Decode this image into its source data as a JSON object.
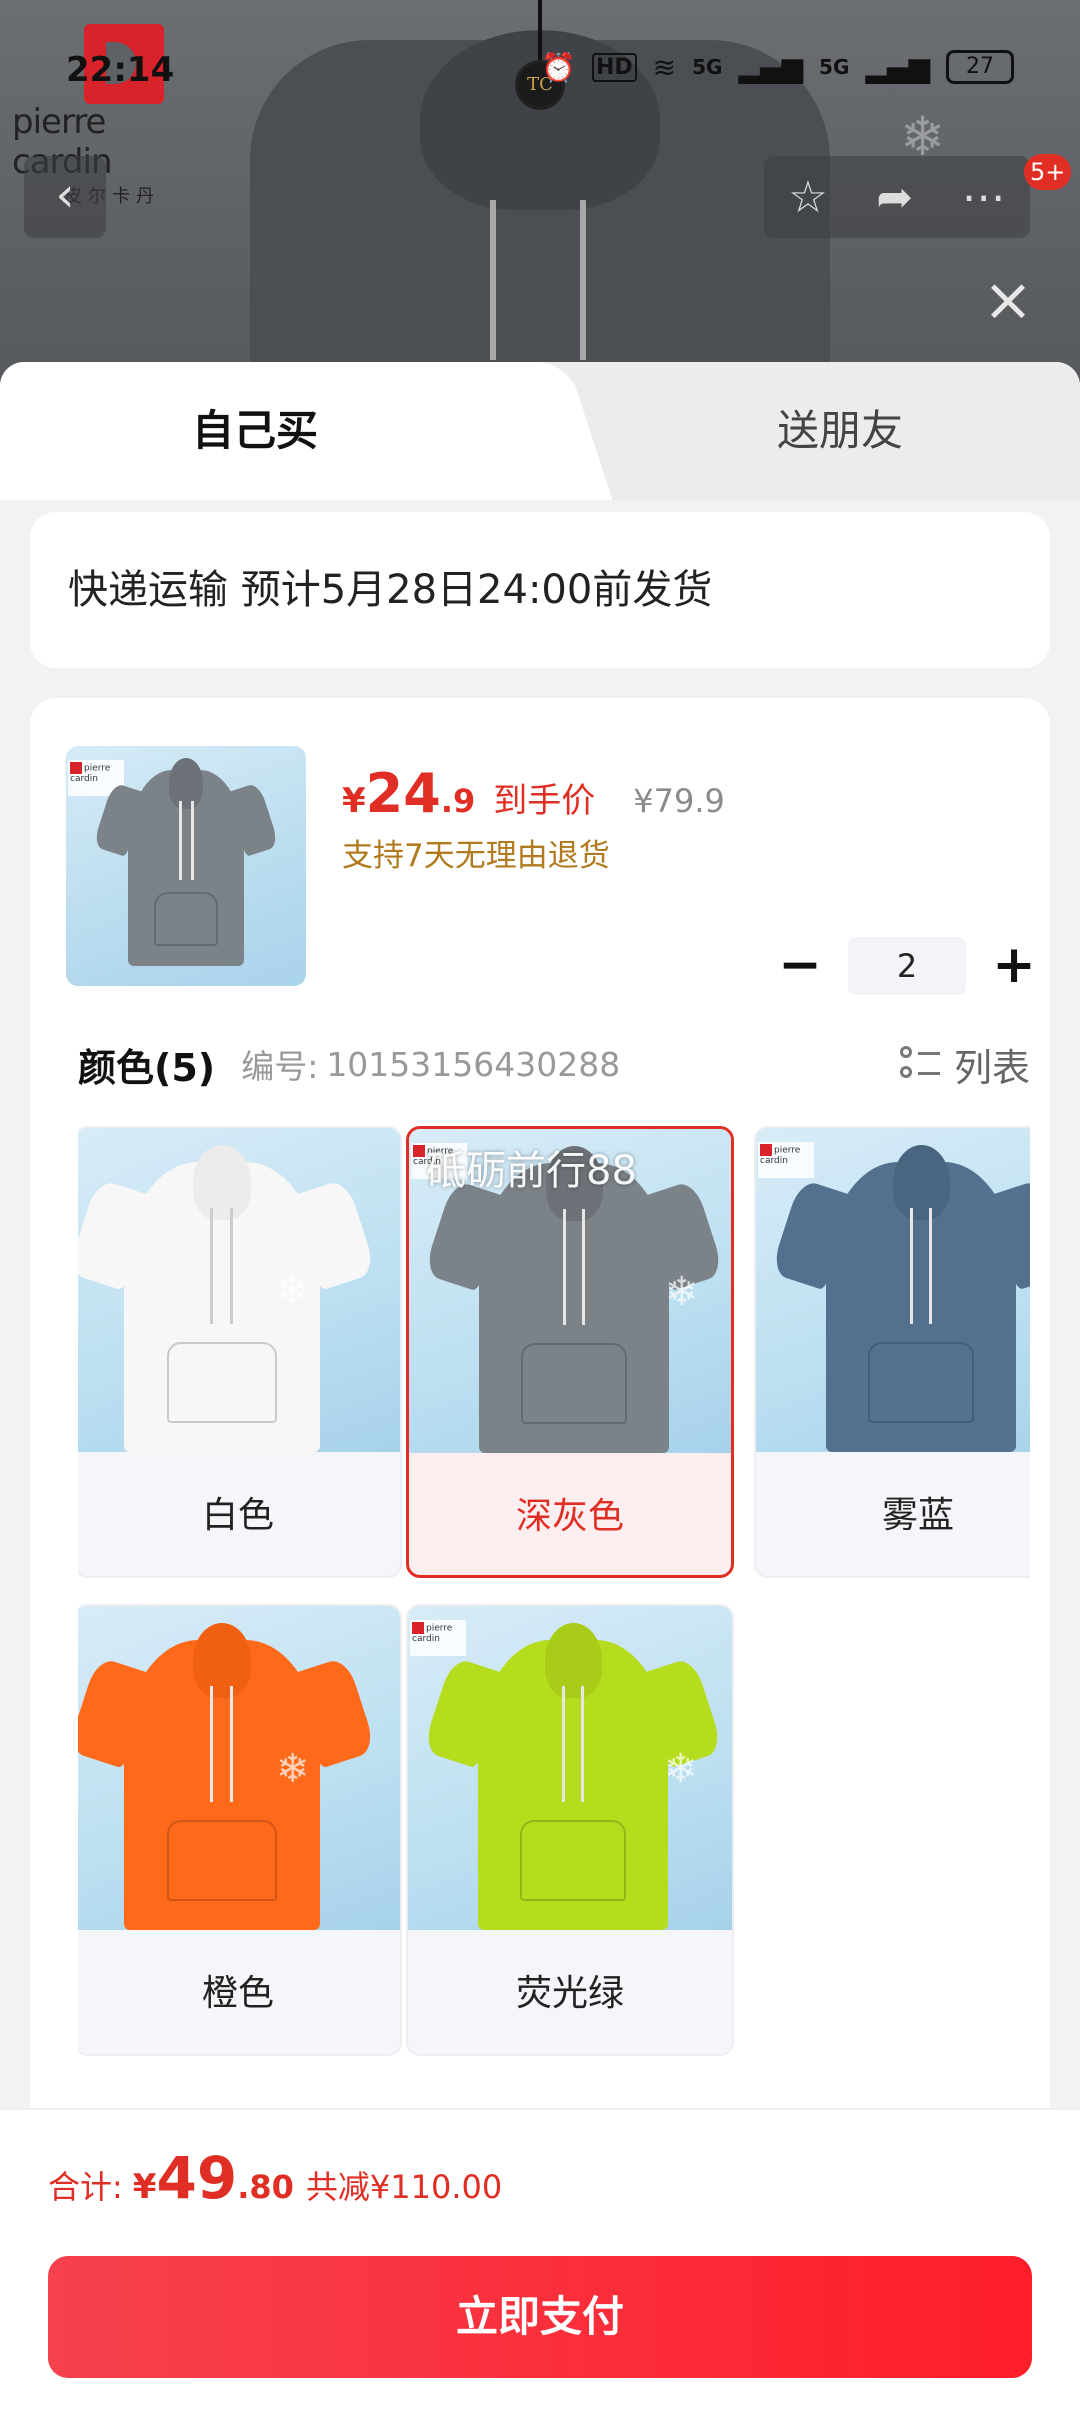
{
  "status_bar": {
    "time": "22:14",
    "battery": "27",
    "network": "5G"
  },
  "brand": {
    "name": "pierre cardin",
    "sub": "皮尔卡丹"
  },
  "nav": {
    "cart_badge": "5+",
    "icons": [
      "back-icon",
      "star-icon",
      "share-icon",
      "more-icon",
      "close-icon"
    ]
  },
  "tabs": {
    "buy_self": "自己买",
    "send_friend": "送朋友"
  },
  "shipping": {
    "text": "快递运输 预计5月28日24:00前发货"
  },
  "product": {
    "price_currency": "¥",
    "price_int": "24",
    "price_dec": ".9",
    "price_tag": "到手价",
    "original_price": "¥79.9",
    "return_policy": "支持7天无理由退货",
    "quantity": "2"
  },
  "color_section": {
    "title": "颜色(5)",
    "code_label": "编号:",
    "code_value": "10153156430288",
    "list_label": "列表",
    "watermark": "砥砺前行88",
    "options": [
      {
        "label": "白色",
        "color": "#f7f7f7",
        "selected": false
      },
      {
        "label": "深灰色",
        "color": "#7b8288",
        "selected": true
      },
      {
        "label": "雾蓝",
        "color": "#53718f",
        "selected": false
      },
      {
        "label": "橙色",
        "color": "#ff6a1a",
        "selected": false
      },
      {
        "label": "荧光绿",
        "color": "#b6dc1e",
        "selected": false
      }
    ]
  },
  "footer": {
    "total_label": "合计:",
    "total_currency": "¥",
    "total_int": "49",
    "total_dec": ".80",
    "savings": "共减¥110.00",
    "pay_button": "立即支付"
  },
  "colors": {
    "accent": "#e02e24",
    "return_text": "#b17a1e"
  }
}
